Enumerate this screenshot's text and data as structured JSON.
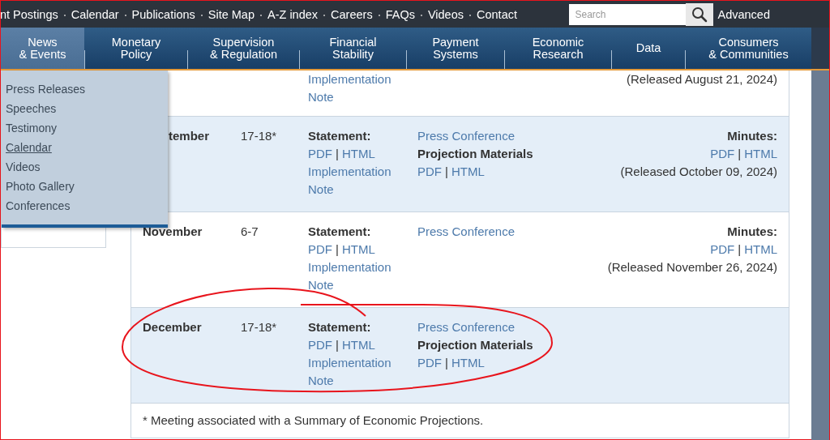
{
  "utility_links": [
    "nt Postings",
    "Calendar",
    "Publications",
    "Site Map",
    "A-Z index",
    "Careers",
    "FAQs",
    "Videos",
    "Contact"
  ],
  "search": {
    "placeholder": "Search",
    "advanced": "Advanced"
  },
  "nav": [
    {
      "lines": [
        "News",
        "& Events"
      ],
      "selected": true
    },
    {
      "lines": [
        "Monetary",
        "Policy"
      ],
      "selected": false
    },
    {
      "lines": [
        "Supervision",
        "& Regulation"
      ],
      "selected": false
    },
    {
      "lines": [
        "Financial",
        "Stability"
      ],
      "selected": false
    },
    {
      "lines": [
        "Payment",
        "Systems"
      ],
      "selected": false
    },
    {
      "lines": [
        "Economic",
        "Research"
      ],
      "selected": false
    },
    {
      "lines": [
        "Data"
      ],
      "selected": false
    },
    {
      "lines": [
        "Consumers",
        "& Communities"
      ],
      "selected": false
    }
  ],
  "dropdown": [
    {
      "label": "Press Releases",
      "selected": false
    },
    {
      "label": "Speeches",
      "selected": false
    },
    {
      "label": "Testimony",
      "selected": false
    },
    {
      "label": "Calendar",
      "selected": true
    },
    {
      "label": "Videos",
      "selected": false
    },
    {
      "label": "Photo Gallery",
      "selected": false
    },
    {
      "label": "Conferences",
      "selected": false
    }
  ],
  "meetings": [
    {
      "statement": {
        "note": "Implementation Note"
      },
      "minutes": {
        "released": "(Released August 21, 2024)"
      }
    },
    {
      "month": "tember",
      "date": "17-18*",
      "statement": {
        "label": "Statement:",
        "links": [
          "PDF",
          "HTML"
        ],
        "separator": "|",
        "note": "Implementation Note"
      },
      "press": {
        "conference": "Press Conference",
        "projection_label": "Projection Materials",
        "links": [
          "PDF",
          "HTML"
        ],
        "separator": "|"
      },
      "minutes": {
        "label": "Minutes:",
        "links": [
          "PDF",
          "HTML"
        ],
        "separator": "|",
        "released": "(Released October 09, 2024)"
      }
    },
    {
      "month": "November",
      "date": "6-7",
      "statement": {
        "label": "Statement:",
        "links": [
          "PDF",
          "HTML"
        ],
        "separator": "|",
        "note": "Implementation Note"
      },
      "press": {
        "conference": "Press Conference"
      },
      "minutes": {
        "label": "Minutes:",
        "links": [
          "PDF",
          "HTML"
        ],
        "separator": "|",
        "released": "(Released November 26, 2024)"
      }
    },
    {
      "month": "December",
      "date": "17-18*",
      "statement": {
        "label": "Statement:",
        "links": [
          "PDF",
          "HTML"
        ],
        "separator": "|",
        "note": "Implementation Note"
      },
      "press": {
        "conference": "Press Conference",
        "projection_label": "Projection Materials",
        "links": [
          "PDF",
          "HTML"
        ],
        "separator": "|"
      }
    }
  ],
  "footnote": "* Meeting associated with a Summary of Economic Projections.",
  "annotations": [
    {
      "kind": "freehand-circle"
    }
  ]
}
